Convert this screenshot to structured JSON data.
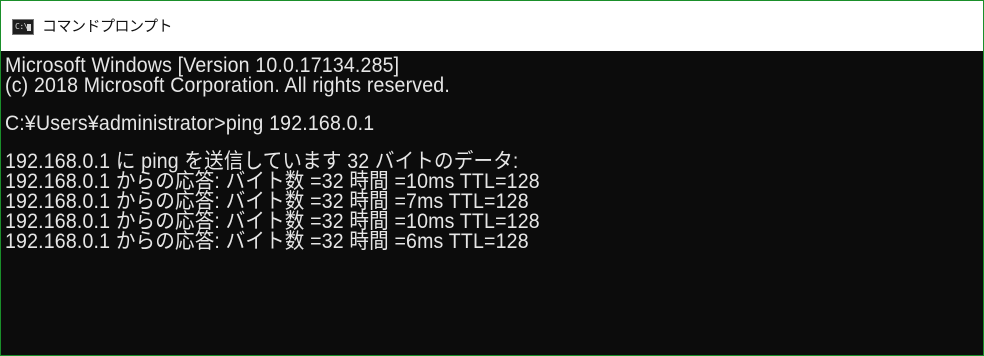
{
  "window": {
    "title": "コマンドプロンプト",
    "icon": "command-prompt-icon",
    "icon_text": "C:\\",
    "border_color": "#1a8f2a"
  },
  "console": {
    "background": "#0c0c0c",
    "foreground": "#e6e6e6",
    "lines": [
      "Microsoft Windows [Version 10.0.17134.285]",
      "(c) 2018 Microsoft Corporation. All rights reserved.",
      "",
      "C:¥Users¥administrator>ping 192.168.0.1",
      "",
      "192.168.0.1 に ping を送信しています 32 バイトのデータ:",
      "192.168.0.1 からの応答: バイト数 =32 時間 =10ms TTL=128",
      "192.168.0.1 からの応答: バイト数 =32 時間 =7ms TTL=128",
      "192.168.0.1 からの応答: バイト数 =32 時間 =10ms TTL=128",
      "192.168.0.1 からの応答: バイト数 =32 時間 =6ms TTL=128"
    ]
  }
}
